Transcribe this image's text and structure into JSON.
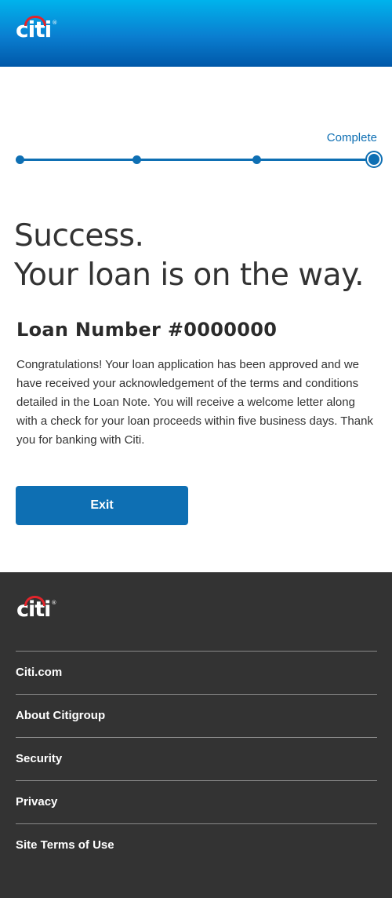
{
  "header": {
    "logo_text": "citi",
    "logo_mark": "®"
  },
  "progress": {
    "label": "Complete",
    "total_steps": 4,
    "current_step": 4
  },
  "main": {
    "headline_line1": "Success.",
    "headline_line2": "Your loan is on the way.",
    "loan_number": "Loan Number #0000000",
    "message": "Congratulations! Your loan application has been approved and we have received your acknowledgement of the terms and conditions detailed in the Loan Note. You will receive a welcome letter along with a check for your loan proceeds within five business days. Thank you for banking with Citi.",
    "exit_label": "Exit"
  },
  "footer": {
    "logo_text": "citi",
    "logo_mark": "®",
    "links": [
      {
        "label": "Citi.com"
      },
      {
        "label": "About Citigroup"
      },
      {
        "label": "Security"
      },
      {
        "label": "Privacy"
      },
      {
        "label": "Site Terms of Use"
      }
    ]
  },
  "colors": {
    "brand_blue": "#0e6fb3",
    "header_gradient_top": "#00b3ec",
    "header_gradient_bottom": "#0058a8",
    "logo_arc": "#e3242b",
    "footer_bg": "#333333"
  }
}
